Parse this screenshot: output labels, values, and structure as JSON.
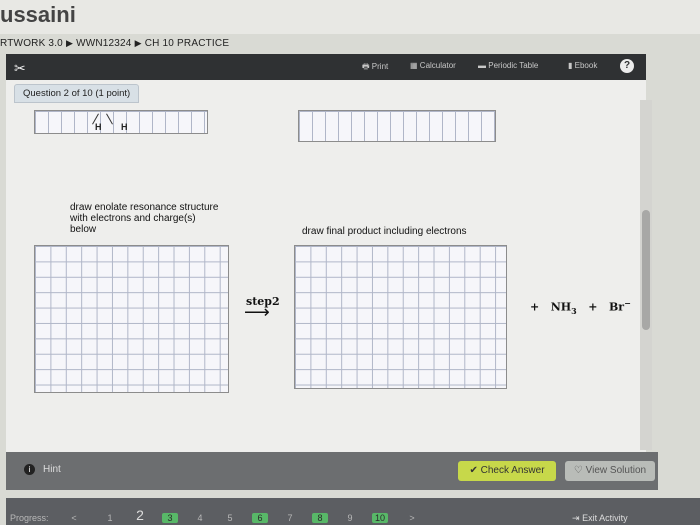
{
  "header": {
    "user_name": "ussaini",
    "breadcrumb": {
      "course": "RTWORK 3.0",
      "section": "WWN12324",
      "assignment": "CH 10 PRACTICE"
    }
  },
  "toolbar": {
    "print": "Print",
    "calculator": "Calculator",
    "periodic_table": "Periodic Table",
    "ebook": "Ebook",
    "help": "?"
  },
  "question": {
    "tab_label": "Question 2 of 10 (1 point)",
    "atoms": [
      "H",
      "H"
    ],
    "enolate_instruction": "draw enolate resonance structure  with electrons and charge(s) below",
    "product_instruction": "draw final product including electrons",
    "step_label": "step2",
    "byproducts": {
      "plus1": "+",
      "nh3": "NH",
      "nh3_sub": "3",
      "plus2": "+",
      "br": "Br",
      "br_sup": "−"
    }
  },
  "footer": {
    "hint": "Hint",
    "check_answer": "Check Answer",
    "view_solution": "View Solution"
  },
  "progress": {
    "label": "Progress:",
    "prev": "<",
    "next": ">",
    "pages": [
      "1",
      "2",
      "3",
      "4",
      "5",
      "6",
      "7",
      "8",
      "9",
      "10"
    ],
    "current": "2",
    "exit": "Exit Activity"
  }
}
